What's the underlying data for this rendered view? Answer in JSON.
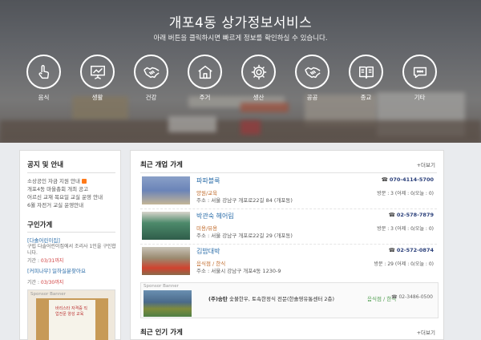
{
  "hero": {
    "title": "개포4동 상가정보서비스",
    "subtitle": "아래 버튼을 클릭하시면 빠르게 정보를 확인하실 수 있습니다.",
    "categories": [
      {
        "label": "음식",
        "icon": "hand-pointer-icon"
      },
      {
        "label": "생활",
        "icon": "presentation-board-icon"
      },
      {
        "label": "건강",
        "icon": "handshake-icon"
      },
      {
        "label": "주거",
        "icon": "house-icon"
      },
      {
        "label": "생산",
        "icon": "gear-icon"
      },
      {
        "label": "공공",
        "icon": "handshake-icon"
      },
      {
        "label": "종교",
        "icon": "book-icon"
      },
      {
        "label": "기타",
        "icon": "speech-bubble-icon"
      }
    ]
  },
  "notice": {
    "title": "공지 및 안내",
    "items": [
      "소상공인 자금 지원 안내",
      "개포4동 마을총회 개최 공고",
      "어르신 교재 목요일 교실 운영 안내",
      "6월 자전거 교실 운영안내"
    ]
  },
  "jobs": {
    "title": "구인가게",
    "items": [
      {
        "name": "[다솔어린이집]",
        "desc": "구립 다솔어린이집에서 조리사 1인을 구인합니다.",
        "date_label": "기간 :",
        "date": "03/31까지"
      },
      {
        "name": "[커피나무] 일하실분찾아요",
        "desc": "",
        "date_label": "기간 :",
        "date": "03/30까지"
      }
    ],
    "sponsor_label": "Sponsor Banner",
    "sponsor_text": "바리스타 자격증 직업전문 양성 교육"
  },
  "recent": {
    "title": "최근 개업 가게",
    "more": "+더보기",
    "shops": [
      {
        "name": "파파블룩",
        "category": "양원/교육",
        "address": "주소 : 서울 강남구 개포로22길 84 (개포동)",
        "phone": "070-4114-5700",
        "visits": "방문 : 3 (어제 : 0/오늘 : 0)"
      },
      {
        "name": "박관숙 헤어림",
        "category": "미용/뷰용",
        "address": "주소 : 서울 강남구 개포로22길 29 (개포동)",
        "phone": "02-578-7879",
        "visits": "방문 : 3 (어제 : 0/오늘 : 0)"
      },
      {
        "name": "김밥대박",
        "category": "음식점 / 한식",
        "address": "주소 : 서울시 강남구 개포4동 1230-9",
        "phone": "02-572-0874",
        "visits": "방문 : 29 (어제 : 0/오늘 : 0)"
      }
    ],
    "sponsor": {
      "label": "Sponsor Banner",
      "name": "(주)송탄",
      "desc": "숯불한우, 토속한정식 전문(한솔영유통센터 2층)",
      "category": "음식점 / 한식",
      "phone": "02-3486-0500"
    }
  },
  "popular": {
    "title": "최근 인기 가게",
    "more": "+더보기"
  },
  "colors": {
    "link": "#2a6ca8",
    "category": "#c06a2a",
    "phone": "#2a3f7a",
    "badge": "#ff7a1a"
  }
}
